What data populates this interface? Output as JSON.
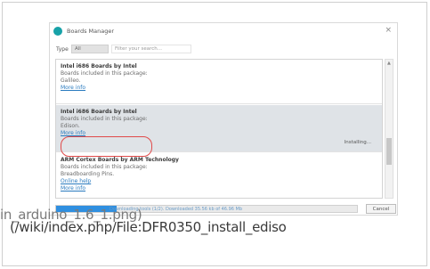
{
  "window": {
    "title": "Boards Manager",
    "close_glyph": "×"
  },
  "filter": {
    "type_label": "Type",
    "type_value": "All",
    "search_placeholder": "Filter your search..."
  },
  "boards": [
    {
      "title": "Intel i686 Boards by Intel",
      "line1": "Boards included in this package:",
      "line2": "Galileo.",
      "link": "More info"
    },
    {
      "title": "Intel i686 Boards by Intel",
      "line1": "Boards included in this package:",
      "line2": "Edison.",
      "link": "More info",
      "selected": true,
      "action": "Installing..."
    },
    {
      "title": "ARM Cortex Boards by ARM Technology",
      "line1": "Boards included in this package:",
      "line2": "Breadboarding Pins.",
      "line3": "Online help",
      "link": "More info"
    }
  ],
  "status": {
    "progress_text": "Downloading tools (1/2). Downloaded 35.56 kb of 46.96 Mb",
    "progress": 0.2,
    "cancel_label": "Cancel"
  },
  "caption": {
    "line1": "in_arduino_1.6_1.png)",
    "line2": "(/wiki/index.php/File:DFR0350_install_ediso"
  },
  "colors": {
    "accent": "#2f8fe0",
    "highlight": "#e04a4a"
  }
}
